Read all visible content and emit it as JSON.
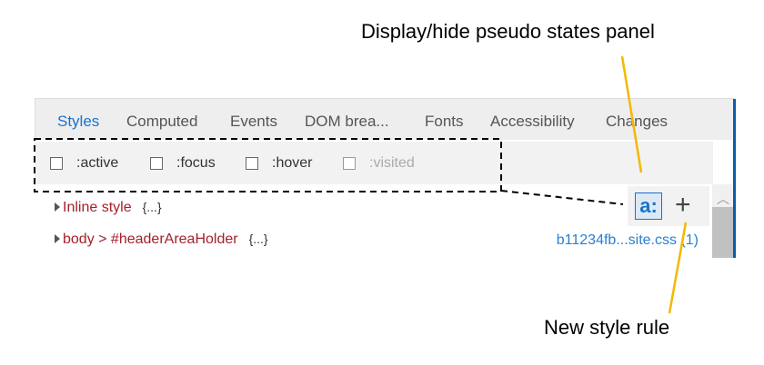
{
  "callouts": {
    "pseudo_panel": "Display/hide pseudo states panel",
    "new_rule": "New style rule"
  },
  "tabs": [
    "Styles",
    "Computed",
    "Events",
    "DOM brea...",
    "Fonts",
    "Accessibility",
    "Changes"
  ],
  "pseudo_states": [
    ":active",
    ":focus",
    ":hover",
    ":visited"
  ],
  "rules": [
    {
      "selector": "Inline style",
      "body": "{...}"
    },
    {
      "selector": "body > #headerAreaHolder",
      "body": "{...}",
      "source": "b11234fb...site.css (1)"
    }
  ],
  "buttons": {
    "pseudo_toggle": "a:",
    "new_rule": "+"
  },
  "colors": {
    "accent": "#1a73c8",
    "callout_line": "#f5b800",
    "selector": "#a5202a"
  }
}
